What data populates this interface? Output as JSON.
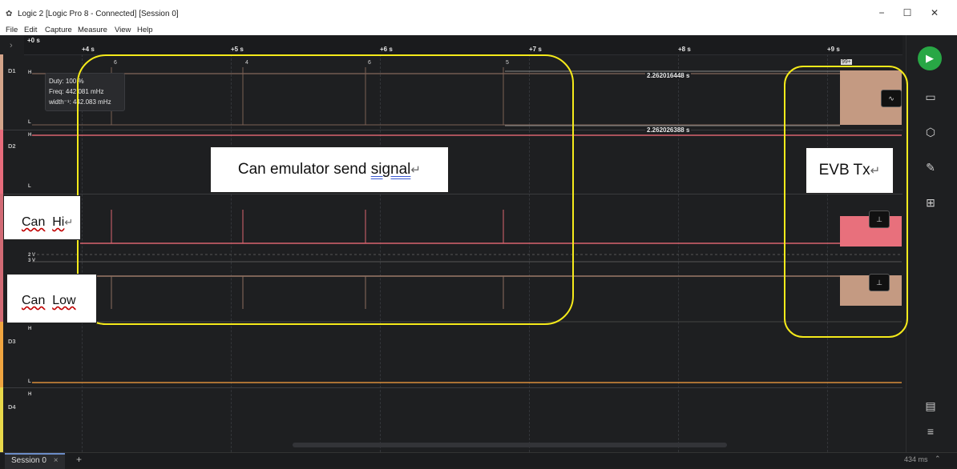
{
  "window": {
    "title": "Logic 2 [Logic Pro 8 - Connected] [Session 0]",
    "minimize": "−",
    "maximize": "☐",
    "close": "✕"
  },
  "menu": [
    "File",
    "Edit",
    "Capture",
    "Measure",
    "View",
    "Help"
  ],
  "ruler": {
    "zero": "+0 s",
    "ticks": [
      "+4 s",
      "+5 s",
      "+6 s",
      "+7 s",
      "+8 s",
      "+9 s"
    ],
    "markers": [
      "6",
      "4",
      "6",
      "5"
    ],
    "badge": "99+"
  },
  "channels": {
    "d1": "D1",
    "d2": "D2",
    "d3": "D3",
    "d4": "D4",
    "high": "H",
    "low": "L",
    "v2": "2 V",
    "v3": "3 V"
  },
  "tooltip": {
    "duty": "Duty: 100 %",
    "freq": "Freq: 442.081 mHz",
    "width": "width⁻¹: 442.083 mHz"
  },
  "measurements": {
    "m1": "2.262016448 s",
    "m2": "2.262026388 s"
  },
  "annotations": {
    "emulator_pre": "Can emulator send ",
    "emulator_word": "signal",
    "evb": "EVB Tx",
    "can_hi_a": "Can",
    "can_hi_b": "Hi",
    "can_low_a": "Can",
    "can_low_b": "Low",
    "para_mark": "↵"
  },
  "session": {
    "tab": "Session 0",
    "close": "×",
    "add": "+",
    "timer": "434 ms"
  },
  "colors": {
    "accent": "#28a745",
    "highlight": "#f5ea1a",
    "d1": "#d4a48a",
    "d2": "#e86c7c",
    "d3": "#f0a540",
    "d4": "#e8d84a"
  }
}
